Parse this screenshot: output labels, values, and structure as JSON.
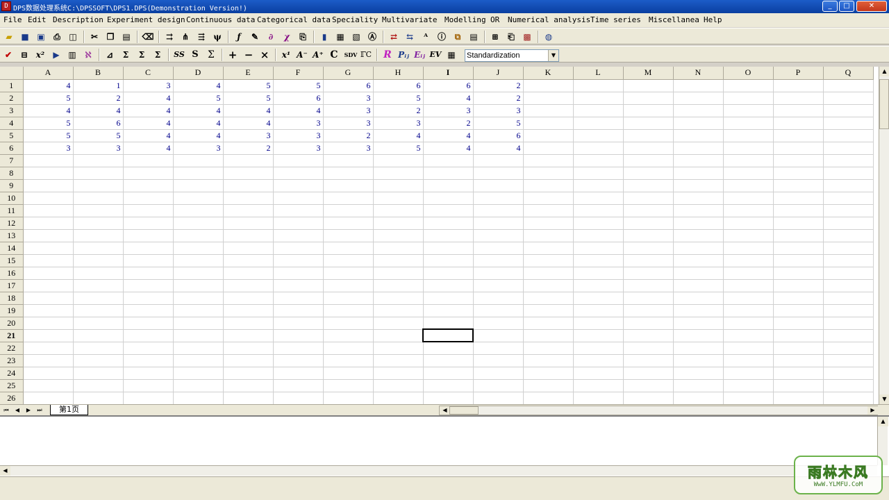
{
  "window": {
    "title": "DPS数据处理系统C:\\DPSSOFT\\DPS1.DPS(Demonstration Version!)",
    "app_icon": "dps-app-icon",
    "controls": [
      "minimize",
      "maximize",
      "close"
    ]
  },
  "menu": [
    "File",
    "Edit",
    "Description",
    "Experiment design",
    "Continuous data",
    "Categorical data",
    "Speciality",
    "Multivariate",
    "Modelling",
    "OR",
    "Numerical analysis",
    "Time series",
    "Miscellanea",
    "Help"
  ],
  "toolbar1": {
    "icons": [
      "open-icon",
      "save-icon",
      "save-as-icon",
      "print-icon",
      "print-preview-icon",
      "cut-icon",
      "copy-icon",
      "paste-icon",
      "eraser-icon",
      "split-icon",
      "tree-icon",
      "merge-icon",
      "branch-icon",
      "fx-icon",
      "pointer-icon",
      "dx-icon",
      "xy-icon",
      "export-icon",
      "bar-chart-icon",
      "table-chart-icon",
      "image-icon",
      "text-box-icon",
      "swap-rows-icon",
      "swap-cols-icon",
      "font-size-icon",
      "info-icon",
      "flowchart-icon",
      "grid-icon",
      "grid-lines-icon",
      "clipboard-icon",
      "palette-icon",
      "globe-icon"
    ]
  },
  "toolbar2": {
    "icons": [
      "check-icon",
      "row-select-icon",
      "x-square-icon",
      "play-icon",
      "form-icon",
      "clear-formula-icon",
      "scale-chart-icon",
      "sigma-sum-icon",
      "sigma-icon",
      "sigma-cum-icon",
      "ss-icon",
      "s-icon",
      "sigma-total-icon",
      "plus-icon",
      "minus-icon",
      "multiply-icon",
      "x-power-icon",
      "a-minus-icon",
      "a-plus-icon",
      "c-icon",
      "sdv-icon",
      "rc-icon",
      "r-icon",
      "pij-icon",
      "eij-icon",
      "ev-icon",
      "calc-icon"
    ],
    "labels": {
      "sdv": "SDV",
      "ev": "EV"
    },
    "method_select": {
      "value": "Standardization"
    }
  },
  "sheet": {
    "columns": [
      "A",
      "B",
      "C",
      "D",
      "E",
      "F",
      "G",
      "H",
      "I",
      "J",
      "K",
      "L",
      "M",
      "N",
      "O",
      "P",
      "Q"
    ],
    "rows": [
      [
        "4",
        "1",
        "3",
        "4",
        "5",
        "5",
        "6",
        "6",
        "6",
        "2",
        "",
        "",
        "",
        "",
        "",
        "",
        ""
      ],
      [
        "5",
        "2",
        "4",
        "5",
        "5",
        "6",
        "3",
        "5",
        "4",
        "2",
        "",
        "",
        "",
        "",
        "",
        "",
        ""
      ],
      [
        "4",
        "4",
        "4",
        "4",
        "4",
        "4",
        "3",
        "2",
        "3",
        "3",
        "",
        "",
        "",
        "",
        "",
        "",
        ""
      ],
      [
        "5",
        "6",
        "4",
        "4",
        "4",
        "3",
        "3",
        "3",
        "2",
        "5",
        "",
        "",
        "",
        "",
        "",
        "",
        ""
      ],
      [
        "5",
        "5",
        "4",
        "4",
        "3",
        "3",
        "2",
        "4",
        "4",
        "6",
        "",
        "",
        "",
        "",
        "",
        "",
        ""
      ],
      [
        "3",
        "3",
        "4",
        "3",
        "2",
        "3",
        "3",
        "5",
        "4",
        "4",
        "",
        "",
        "",
        "",
        "",
        "",
        ""
      ]
    ],
    "total_rows": 26,
    "active_cell": {
      "row": 21,
      "col": "I"
    },
    "tab_name": "第1页"
  },
  "watermark": {
    "text": "雨林木风",
    "url": "WwW.YLMFU.CoM"
  }
}
